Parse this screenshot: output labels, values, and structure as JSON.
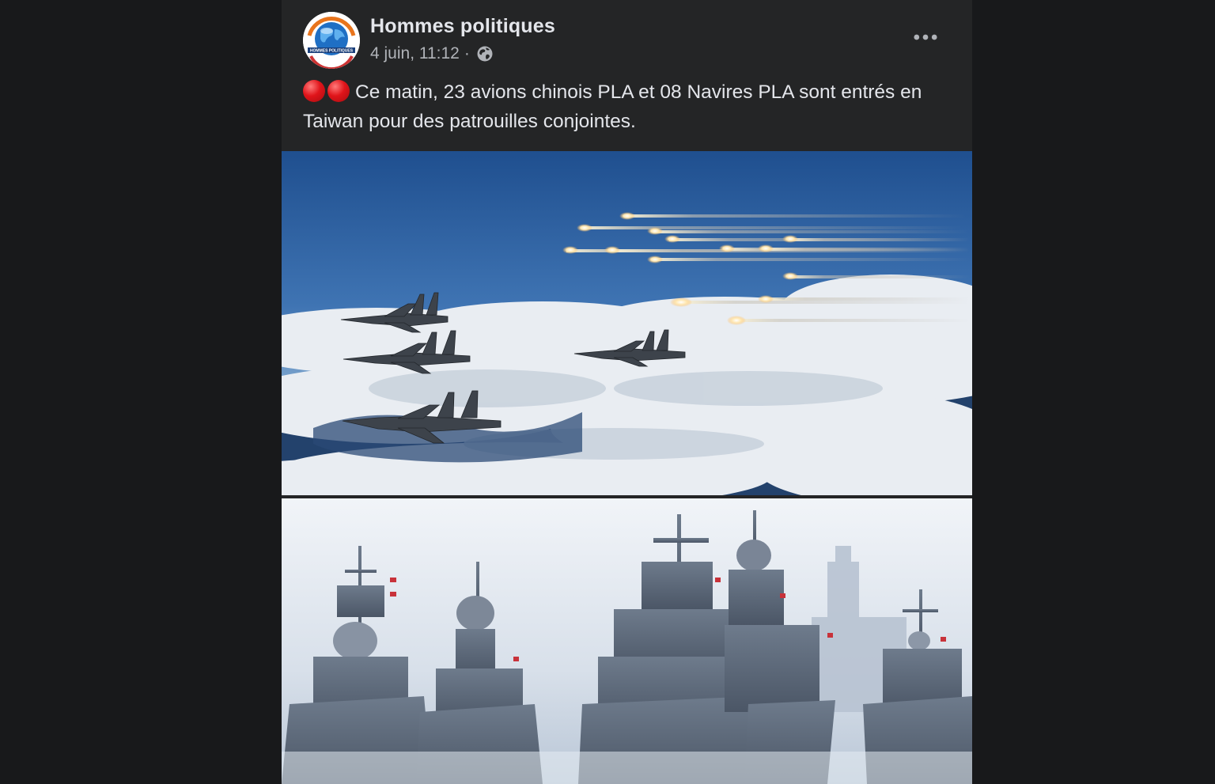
{
  "post": {
    "page_name": "Hommes politiques",
    "timestamp": "4 juin, 11:12",
    "separator": "·",
    "privacy_icon": "globe-icon",
    "more_icon": "more-options-icon",
    "avatar_text": "HOMMES POLITIQUES",
    "text": "Ce matin, 23 avions chinois PLA et 08 Navires PLA sont entrés en Taiwan pour des patrouilles conjointes.",
    "emoji": [
      "red-circle",
      "red-circle"
    ]
  },
  "images": {
    "top": {
      "subject": "fighter-jets-over-clouds"
    },
    "bottom": {
      "subject": "warships-fleet"
    }
  },
  "colors": {
    "background": "#18191b",
    "card": "#242526",
    "primary_text": "#e4e6eb",
    "secondary_text": "#b0b3b8"
  }
}
